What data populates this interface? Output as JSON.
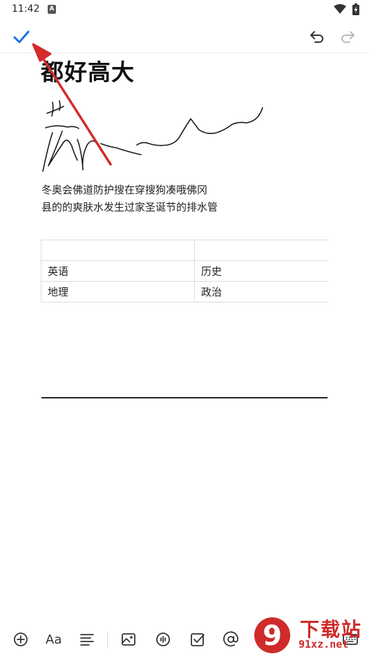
{
  "status_bar": {
    "time": "11:42",
    "notification_icon_letter": "A",
    "icons": [
      "wifi-icon",
      "battery-charging-icon"
    ]
  },
  "toolbar": {
    "icons": [
      "checkmark-icon",
      "undo-icon",
      "redo-icon"
    ],
    "accent_color": "#1a73e8"
  },
  "note": {
    "title": "都好高大",
    "body_lines": [
      "冬奥会佛道防护搜在穿搜狗凑哦佛冈",
      "县的的爽肤水发生过家圣诞节的排水管"
    ],
    "table": {
      "rows": [
        [
          "",
          ""
        ],
        [
          "英语",
          "历史"
        ],
        [
          "地理",
          "政治"
        ]
      ]
    }
  },
  "bottom_toolbar": {
    "icons": [
      "add-icon",
      "text-format-icon",
      "paragraph-align-icon",
      "image-icon",
      "audio-icon",
      "checkbox-icon",
      "mention-icon",
      "keyboard-icon"
    ],
    "text_format_glyph": "Aa"
  },
  "annotation": {
    "arrow_color": "#d42a2a"
  },
  "watermark": {
    "text_cn": "下载站",
    "text_url": "91xz.net",
    "logo_text": "9"
  }
}
